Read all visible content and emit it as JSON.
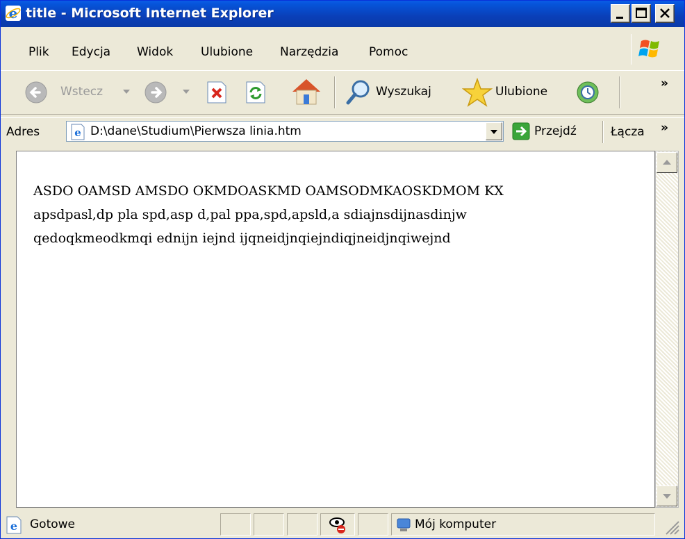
{
  "window": {
    "title": "title - Microsoft Internet Explorer"
  },
  "menu": {
    "items": [
      "Plik",
      "Edycja",
      "Widok",
      "Ulubione",
      "Narzędzia",
      "Pomoc"
    ]
  },
  "toolbar": {
    "back_label": "Wstecz",
    "search_label": "Wyszukaj",
    "favorites_label": "Ulubione",
    "more_label": "»"
  },
  "address": {
    "label": "Adres",
    "value": "D:\\dane\\Studium\\Pierwsza linia.htm",
    "go_label": "Przejdź",
    "links_label": "Łącza",
    "more_label": "»"
  },
  "content": {
    "lines": [
      "ASDO OAMSD AMSDO OKMDOASKMD OAMSODMKAOSKDMOM KX",
      "apsdpasl,dp pla spd,asp d,pal ppa,spd,apsld,a sdiajnsdijnasdinjw",
      "qedoqkmeodkmqi ednijn iejnd ijqneidjnqiejndiqjneidjnqiwejnd"
    ]
  },
  "status": {
    "text": "Gotowe",
    "zone": "Mój komputer"
  },
  "colors": {
    "titlebar": "#0a3fb8",
    "chrome": "#ece9d8",
    "content_bg": "#ffffff"
  }
}
